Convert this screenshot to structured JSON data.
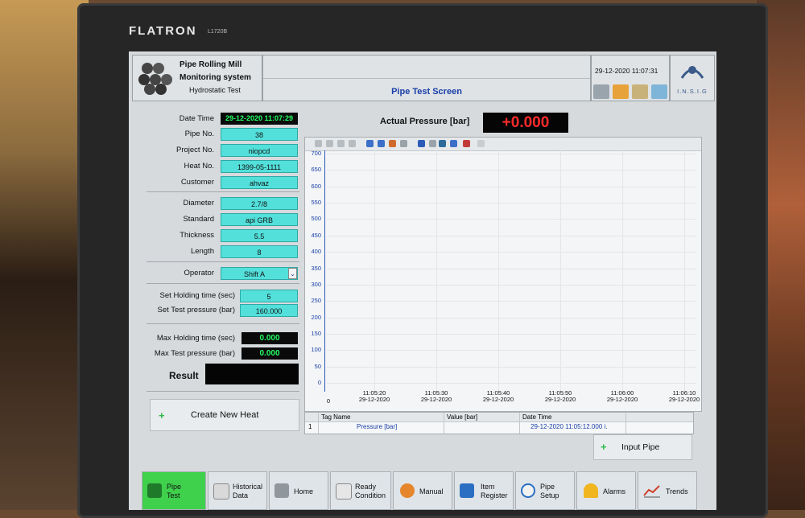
{
  "monitor": {
    "brand": "FLATRON",
    "model": "L1720B"
  },
  "header": {
    "app_title_1": "Pipe Rolling Mill",
    "app_title_2": "Monitoring system",
    "app_title_3": "Hydrostatic Test",
    "screen_title": "Pipe Test Screen",
    "datetime": "29-12-2020 11:07:31",
    "company": "I.N.S.I.G"
  },
  "form": {
    "date_time_label": "Date Time",
    "date_time_value": "29-12-2020 11:07:29",
    "pipe_no_label": "Pipe No.",
    "pipe_no": "38",
    "project_no_label": "Project No.",
    "project_no": "niopcd",
    "heat_no_label": "Heat No.",
    "heat_no": "1399-05-1111",
    "customer_label": "Customer",
    "customer": "ahvaz",
    "diameter_label": "Diameter",
    "diameter": "2.7/8",
    "standard_label": "Standard",
    "standard": "api GRB",
    "thickness_label": "Thickness",
    "thickness": "5.5",
    "length_label": "Length",
    "length": "8",
    "operator_label": "Operator",
    "operator": "Shift A",
    "set_holding_label": "Set Holding time (sec)",
    "set_holding": "5",
    "set_pressure_label": "Set Test pressure (bar)",
    "set_pressure": "160.000",
    "max_holding_label": "Max Holding time (sec)",
    "max_holding": "0.000",
    "max_pressure_label": "Max Test pressure (bar)",
    "max_pressure": "0.000",
    "result_label": "Result",
    "create_heat_label": "Create New Heat"
  },
  "pressure": {
    "label": "Actual Pressure [bar]",
    "value": "+0.000"
  },
  "chart_data": {
    "type": "line",
    "y_ticks": [
      "700",
      "650",
      "600",
      "550",
      "500",
      "450",
      "400",
      "350",
      "300",
      "250",
      "200",
      "150",
      "100",
      "50",
      "0"
    ],
    "x_ticks": [
      {
        "time": "0",
        "date": ""
      },
      {
        "time": "11:05:20",
        "date": "29-12-2020"
      },
      {
        "time": "11:05:30",
        "date": "29-12-2020"
      },
      {
        "time": "11:05:40",
        "date": "29-12-2020"
      },
      {
        "time": "11:05:50",
        "date": "29-12-2020"
      },
      {
        "time": "11:06:00",
        "date": "29-12-2020"
      },
      {
        "time": "11:06:10",
        "date": "29-12-2020"
      }
    ],
    "ylim": [
      0,
      700
    ],
    "grid": true,
    "series": []
  },
  "table": {
    "headers": [
      "Tag Name",
      "Value [bar]",
      "Date Time"
    ],
    "rows": [
      {
        "index": "1",
        "tag": "Pressure [bar]",
        "value": "",
        "datetime": "29-12-2020 11:05:12.000 i."
      }
    ]
  },
  "input_pipe_label": "Input Pipe",
  "nav": [
    {
      "l1": "Pipe",
      "l2": "Test"
    },
    {
      "l1": "Historical",
      "l2": "Data"
    },
    {
      "l1": "Home",
      "l2": ""
    },
    {
      "l1": "Ready",
      "l2": "Condition"
    },
    {
      "l1": "Manual",
      "l2": ""
    },
    {
      "l1": "Item",
      "l2": "Register"
    },
    {
      "l1": "Pipe",
      "l2": "Setup"
    },
    {
      "l1": "Alarms",
      "l2": ""
    },
    {
      "l1": "Trends",
      "l2": ""
    }
  ],
  "colors": {
    "field": "#53e0db",
    "accent_green": "#23ff63",
    "pressure_red": "#ff2b2b",
    "title_blue": "#1a3fa8"
  }
}
